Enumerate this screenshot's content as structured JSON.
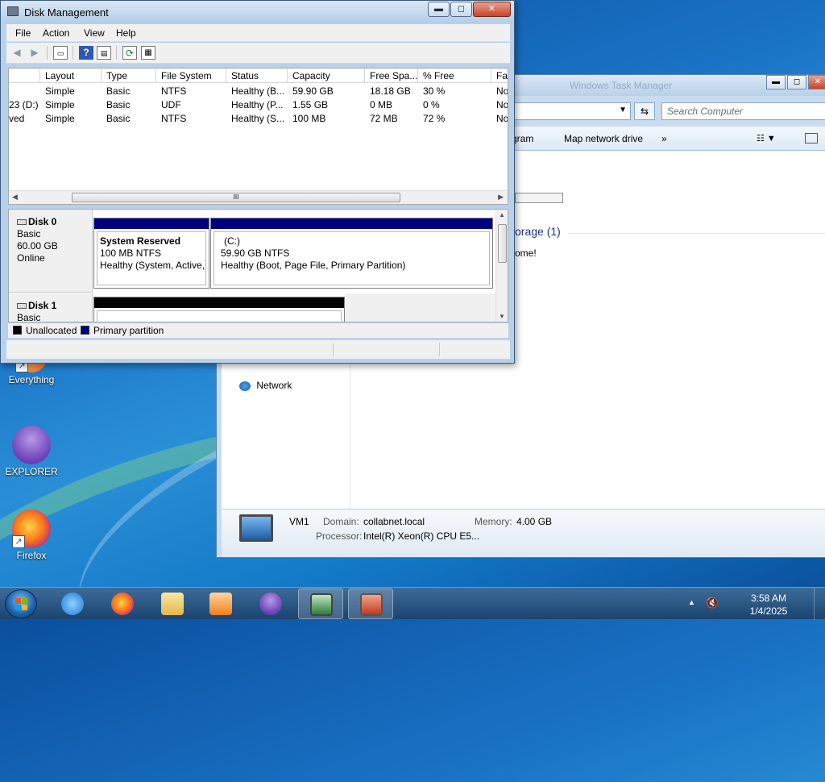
{
  "disk_management": {
    "title": "Disk Management",
    "window_controls": {
      "minimize": "▬",
      "maximize": "◻",
      "close": "✕"
    },
    "menu": [
      "File",
      "Action",
      "View",
      "Help"
    ],
    "volume_list": {
      "columns": [
        "Layout",
        "Type",
        "File System",
        "Status",
        "Capacity",
        "Free Spa...",
        "% Free",
        "Fau"
      ],
      "rows": [
        {
          "volume": "",
          "layout": "Simple",
          "type": "Basic",
          "fs": "NTFS",
          "status": "Healthy (B...",
          "capacity": "59.90 GB",
          "free": "18.18 GB",
          "pct": "30 %",
          "fault": "No"
        },
        {
          "volume": "23 (D:)",
          "layout": "Simple",
          "type": "Basic",
          "fs": "UDF",
          "status": "Healthy (P...",
          "capacity": "1.55 GB",
          "free": "0 MB",
          "pct": "0 %",
          "fault": "No"
        },
        {
          "volume": "ved",
          "layout": "Simple",
          "type": "Basic",
          "fs": "NTFS",
          "status": "Healthy (S...",
          "capacity": "100 MB",
          "free": "72 MB",
          "pct": "72 %",
          "fault": "No"
        }
      ],
      "scroll_thumb_grip": "III"
    },
    "disks": [
      {
        "name": "Disk 0",
        "type": "Basic",
        "size": "60.00 GB",
        "state": "Online",
        "partitions": [
          {
            "name": "System Reserved",
            "size_fs": "100 MB NTFS",
            "status": "Healthy (System, Active,",
            "color": "#00007f"
          },
          {
            "name": "(C:)",
            "size_fs": "59.90 GB NTFS",
            "status": "Healthy (Boot, Page File, Primary Partition)",
            "color": "#00007f"
          }
        ]
      },
      {
        "name": "Disk 1",
        "type": "Basic",
        "partitions": [
          {
            "color": "#000000"
          }
        ]
      }
    ],
    "legend": [
      {
        "label": "Unallocated",
        "color": "#000000"
      },
      {
        "label": "Primary partition",
        "color": "#00007f"
      }
    ]
  },
  "explorer": {
    "title": "Windows Task Manager",
    "search_placeholder": "Search Computer",
    "commands": [
      "gram",
      "Map network drive",
      "»"
    ],
    "section": "orage (1)",
    "section_detail": "ome!",
    "nav_network": "Network",
    "details": {
      "computer_name": "VM1",
      "domain_label": "Domain:",
      "domain_value": "collabnet.local",
      "memory_label": "Memory:",
      "memory_value": "4.00 GB",
      "processor_label": "Processor:",
      "processor_value": "Intel(R) Xeon(R) CPU E5..."
    }
  },
  "desktop_icons": [
    "Everything",
    "EXPLORER",
    "Firefox"
  ],
  "taskbar": {
    "buttons": [
      "start-button",
      "ie-icon",
      "firefox-icon",
      "explorer-folder-icon",
      "media-player-icon",
      "explorer-app-icon",
      "task-manager-icon",
      "disk-management-icon"
    ],
    "time": "3:58 AM",
    "date": "1/4/2025"
  },
  "colors": {
    "partition_primary": "#00007f",
    "unallocated": "#000000",
    "desktop_blue": "#1a73c6"
  }
}
